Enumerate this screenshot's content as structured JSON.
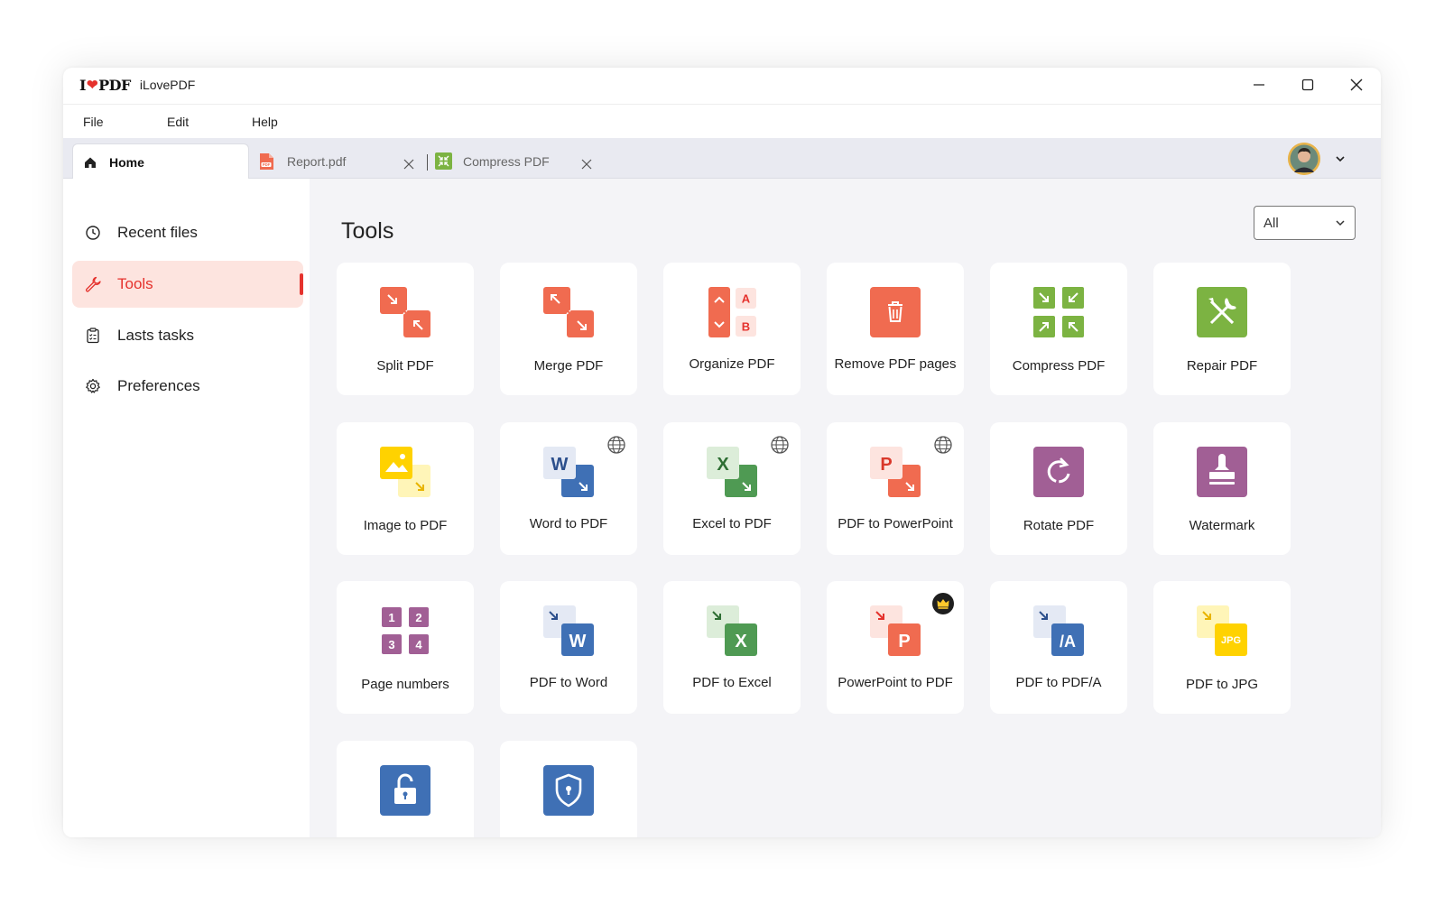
{
  "app": {
    "logo_text_left": "I",
    "logo_heart": "❤",
    "logo_text_right": "PDF",
    "name": "iLovePDF"
  },
  "menu": [
    "File",
    "Edit",
    "Help"
  ],
  "tabs": [
    {
      "label": "Home",
      "icon": "home-icon",
      "active": true
    },
    {
      "label": "Report.pdf",
      "icon": "pdf-file-icon",
      "active": false
    },
    {
      "label": "Compress PDF",
      "icon": "compress-icon",
      "active": false
    }
  ],
  "sidebar": {
    "items": [
      {
        "label": "Recent files",
        "icon": "clock-icon"
      },
      {
        "label": "Tools",
        "icon": "wrench-icon",
        "active": true
      },
      {
        "label": "Lasts tasks",
        "icon": "clipboard-icon"
      },
      {
        "label": "Preferences",
        "icon": "gear-icon"
      }
    ]
  },
  "main": {
    "title": "Tools",
    "filter": {
      "selected": "All"
    },
    "tools": [
      {
        "label": "Split PDF",
        "icon": "split-pdf-icon"
      },
      {
        "label": "Merge PDF",
        "icon": "merge-pdf-icon"
      },
      {
        "label": "Organize PDF",
        "icon": "organize-pdf-icon",
        "icon_letters": [
          "A",
          "B"
        ]
      },
      {
        "label": "Remove PDF pages",
        "icon": "trash-icon"
      },
      {
        "label": "Compress PDF",
        "icon": "compress-icon"
      },
      {
        "label": "Repair PDF",
        "icon": "repair-icon"
      },
      {
        "label": "Image to PDF",
        "icon": "image-icon"
      },
      {
        "label": "Word to PDF",
        "icon": "word-icon",
        "icon_letter": "W",
        "badge": "globe-icon"
      },
      {
        "label": "Excel to PDF",
        "icon": "excel-icon",
        "icon_letter": "X",
        "badge": "globe-icon"
      },
      {
        "label": "PDF to PowerPoint",
        "icon": "powerpoint-icon",
        "icon_letter": "P",
        "badge": "globe-icon"
      },
      {
        "label": "Rotate PDF",
        "icon": "rotate-icon"
      },
      {
        "label": "Watermark",
        "icon": "stamp-icon"
      },
      {
        "label": "Page numbers",
        "icon": "page-numbers-icon",
        "icon_numbers": [
          "1",
          "2",
          "3",
          "4"
        ]
      },
      {
        "label": "PDF to Word",
        "icon": "word-icon",
        "icon_letter": "W"
      },
      {
        "label": "PDF to Excel",
        "icon": "excel-icon",
        "icon_letter": "X"
      },
      {
        "label": "PowerPoint to PDF",
        "icon": "powerpoint-icon",
        "icon_letter": "P",
        "badge": "crown-icon"
      },
      {
        "label": "PDF to PDF/A",
        "icon": "pdfa-icon",
        "icon_letter": "/A"
      },
      {
        "label": "PDF to JPG",
        "icon": "jpg-icon",
        "icon_letter": "JPG"
      },
      {
        "label": "",
        "icon": "unlock-icon"
      },
      {
        "label": "",
        "icon": "shield-icon"
      }
    ]
  },
  "colors": {
    "brand_red": "#e5322d",
    "tool_red": "#f06b50",
    "tool_green": "#7cb342",
    "tool_blue": "#3f70b5",
    "tool_purple": "#a15f95",
    "tool_yellow": "#ffd200",
    "sidebar_active_bg": "#fde4df"
  }
}
